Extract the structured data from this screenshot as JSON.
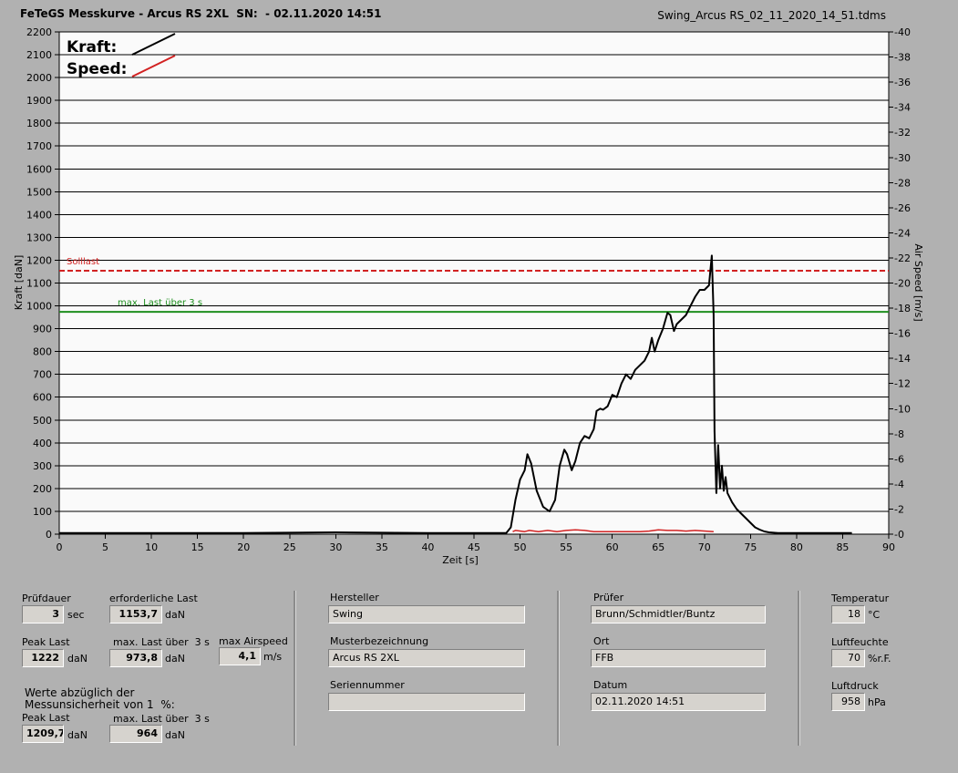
{
  "header": {
    "title": "FeTeGS Messkurve - Arcus RS 2XL  SN:  - 02.11.2020 14:51",
    "filename": "Swing_Arcus RS_02_11_2020_14_51.tdms"
  },
  "chart_data": {
    "type": "line",
    "title": "",
    "xlabel": "Zeit [s]",
    "ylabel": "Kraft [daN]",
    "y2label": "Air Speed [m/s]",
    "xlim": [
      0,
      90
    ],
    "ylim": [
      0,
      2200
    ],
    "y2lim": [
      0,
      40
    ],
    "x_ticks": [
      0,
      5,
      10,
      15,
      20,
      25,
      30,
      35,
      40,
      45,
      50,
      55,
      60,
      65,
      70,
      75,
      80,
      85,
      90
    ],
    "y_ticks": [
      0,
      100,
      200,
      300,
      400,
      500,
      600,
      700,
      800,
      900,
      1000,
      1100,
      1200,
      1300,
      1400,
      1500,
      1600,
      1700,
      1800,
      1900,
      2000,
      2100,
      2200
    ],
    "y2_ticks": [
      0,
      2,
      4,
      6,
      8,
      10,
      12,
      14,
      16,
      18,
      20,
      22,
      24,
      26,
      28,
      30,
      32,
      34,
      36,
      38,
      40
    ],
    "grid": true,
    "legend": [
      {
        "name": "Kraft:",
        "color": "#000000"
      },
      {
        "name": "Speed:",
        "color": "#d22222"
      }
    ],
    "reference_lines": [
      {
        "label": "Solllast",
        "value": 1153.7,
        "color": "#d22222",
        "style": "dashed"
      },
      {
        "label": "max. Last über  3 s",
        "value": 973.8,
        "color": "#1f8f1f",
        "style": "solid"
      }
    ],
    "series": [
      {
        "name": "Kraft:",
        "color": "#000000",
        "x": [
          0,
          10,
          20,
          30,
          40,
          48.5,
          49,
          49.5,
          50,
          50.5,
          50.8,
          51.2,
          51.8,
          52.5,
          53.2,
          53.8,
          54.3,
          54.8,
          55.1,
          55.6,
          56,
          56.5,
          57,
          57.5,
          58,
          58.3,
          58.7,
          59,
          59.5,
          60,
          60.5,
          61,
          61.5,
          62,
          62.5,
          63,
          63.5,
          64,
          64.3,
          64.6,
          65,
          65.5,
          66,
          66.3,
          66.7,
          67,
          67.5,
          68,
          68.5,
          69,
          69.5,
          70,
          70.5,
          70.8,
          71.0,
          71.1,
          71.3,
          71.5,
          71.7,
          71.9,
          72.1,
          72.3,
          72.5,
          73,
          73.5,
          74,
          74.5,
          75,
          75.5,
          76,
          76.5,
          77,
          78,
          80,
          82,
          84,
          86
        ],
        "y": [
          5,
          5,
          5,
          8,
          5,
          5,
          30,
          150,
          240,
          280,
          350,
          310,
          190,
          120,
          100,
          150,
          300,
          370,
          350,
          280,
          320,
          400,
          430,
          420,
          460,
          540,
          550,
          545,
          560,
          610,
          600,
          660,
          700,
          680,
          720,
          740,
          760,
          800,
          860,
          800,
          850,
          900,
          970,
          960,
          890,
          920,
          940,
          960,
          1000,
          1040,
          1070,
          1070,
          1090,
          1220,
          960,
          450,
          180,
          390,
          200,
          300,
          190,
          250,
          180,
          140,
          110,
          90,
          70,
          50,
          30,
          20,
          12,
          8,
          5,
          5,
          5,
          5,
          5
        ]
      },
      {
        "name": "Speed:",
        "color": "#d22222",
        "x": [
          49.2,
          49.5,
          50.5,
          51,
          52,
          53,
          54,
          55,
          56,
          57,
          58,
          63,
          64,
          65,
          66,
          67,
          68,
          69,
          71
        ],
        "y": [
          0.2,
          0.3,
          0.2,
          0.3,
          0.2,
          0.3,
          0.2,
          0.3,
          0.35,
          0.3,
          0.2,
          0.2,
          0.25,
          0.35,
          0.3,
          0.3,
          0.25,
          0.3,
          0.2
        ]
      }
    ]
  },
  "panel": {
    "pruefdauer": {
      "label": "Prüfdauer",
      "value": "3",
      "unit": "sec"
    },
    "erforderliche_last": {
      "label": "erforderliche Last",
      "value": "1153,7",
      "unit": "daN"
    },
    "peak_last": {
      "label": "Peak Last",
      "value": "1222",
      "unit": "daN"
    },
    "max_last": {
      "label": "max. Last über  3 s",
      "value": "973,8",
      "unit": "daN"
    },
    "max_airspeed": {
      "label": "max Airspeed",
      "value": "4,1",
      "unit": "m/s"
    },
    "werte_note": "Werte abzüglich der\nMessunsicherheit von 1  %:",
    "peak_last_corr": {
      "label": "Peak Last",
      "value": "1209,7",
      "unit": "daN"
    },
    "max_last_corr": {
      "label": "max. Last über  3 s",
      "value": "964",
      "unit": "daN"
    },
    "hersteller": {
      "label": "Hersteller",
      "value": "Swing"
    },
    "muster": {
      "label": "Musterbezeichnung",
      "value": "Arcus RS 2XL"
    },
    "serien": {
      "label": "Seriennummer",
      "value": ""
    },
    "pruefer": {
      "label": "Prüfer",
      "value": "Brunn/Schmidtler/Buntz"
    },
    "ort": {
      "label": "Ort",
      "value": "FFB"
    },
    "datum": {
      "label": "Datum",
      "value": "02.11.2020 14:51"
    },
    "temperatur": {
      "label": "Temperatur",
      "value": "18",
      "unit": "°C"
    },
    "luftfeuchte": {
      "label": "Luftfeuchte",
      "value": "70",
      "unit": "%r.F."
    },
    "luftdruck": {
      "label": "Luftdruck",
      "value": "958",
      "unit": "hPa"
    }
  }
}
